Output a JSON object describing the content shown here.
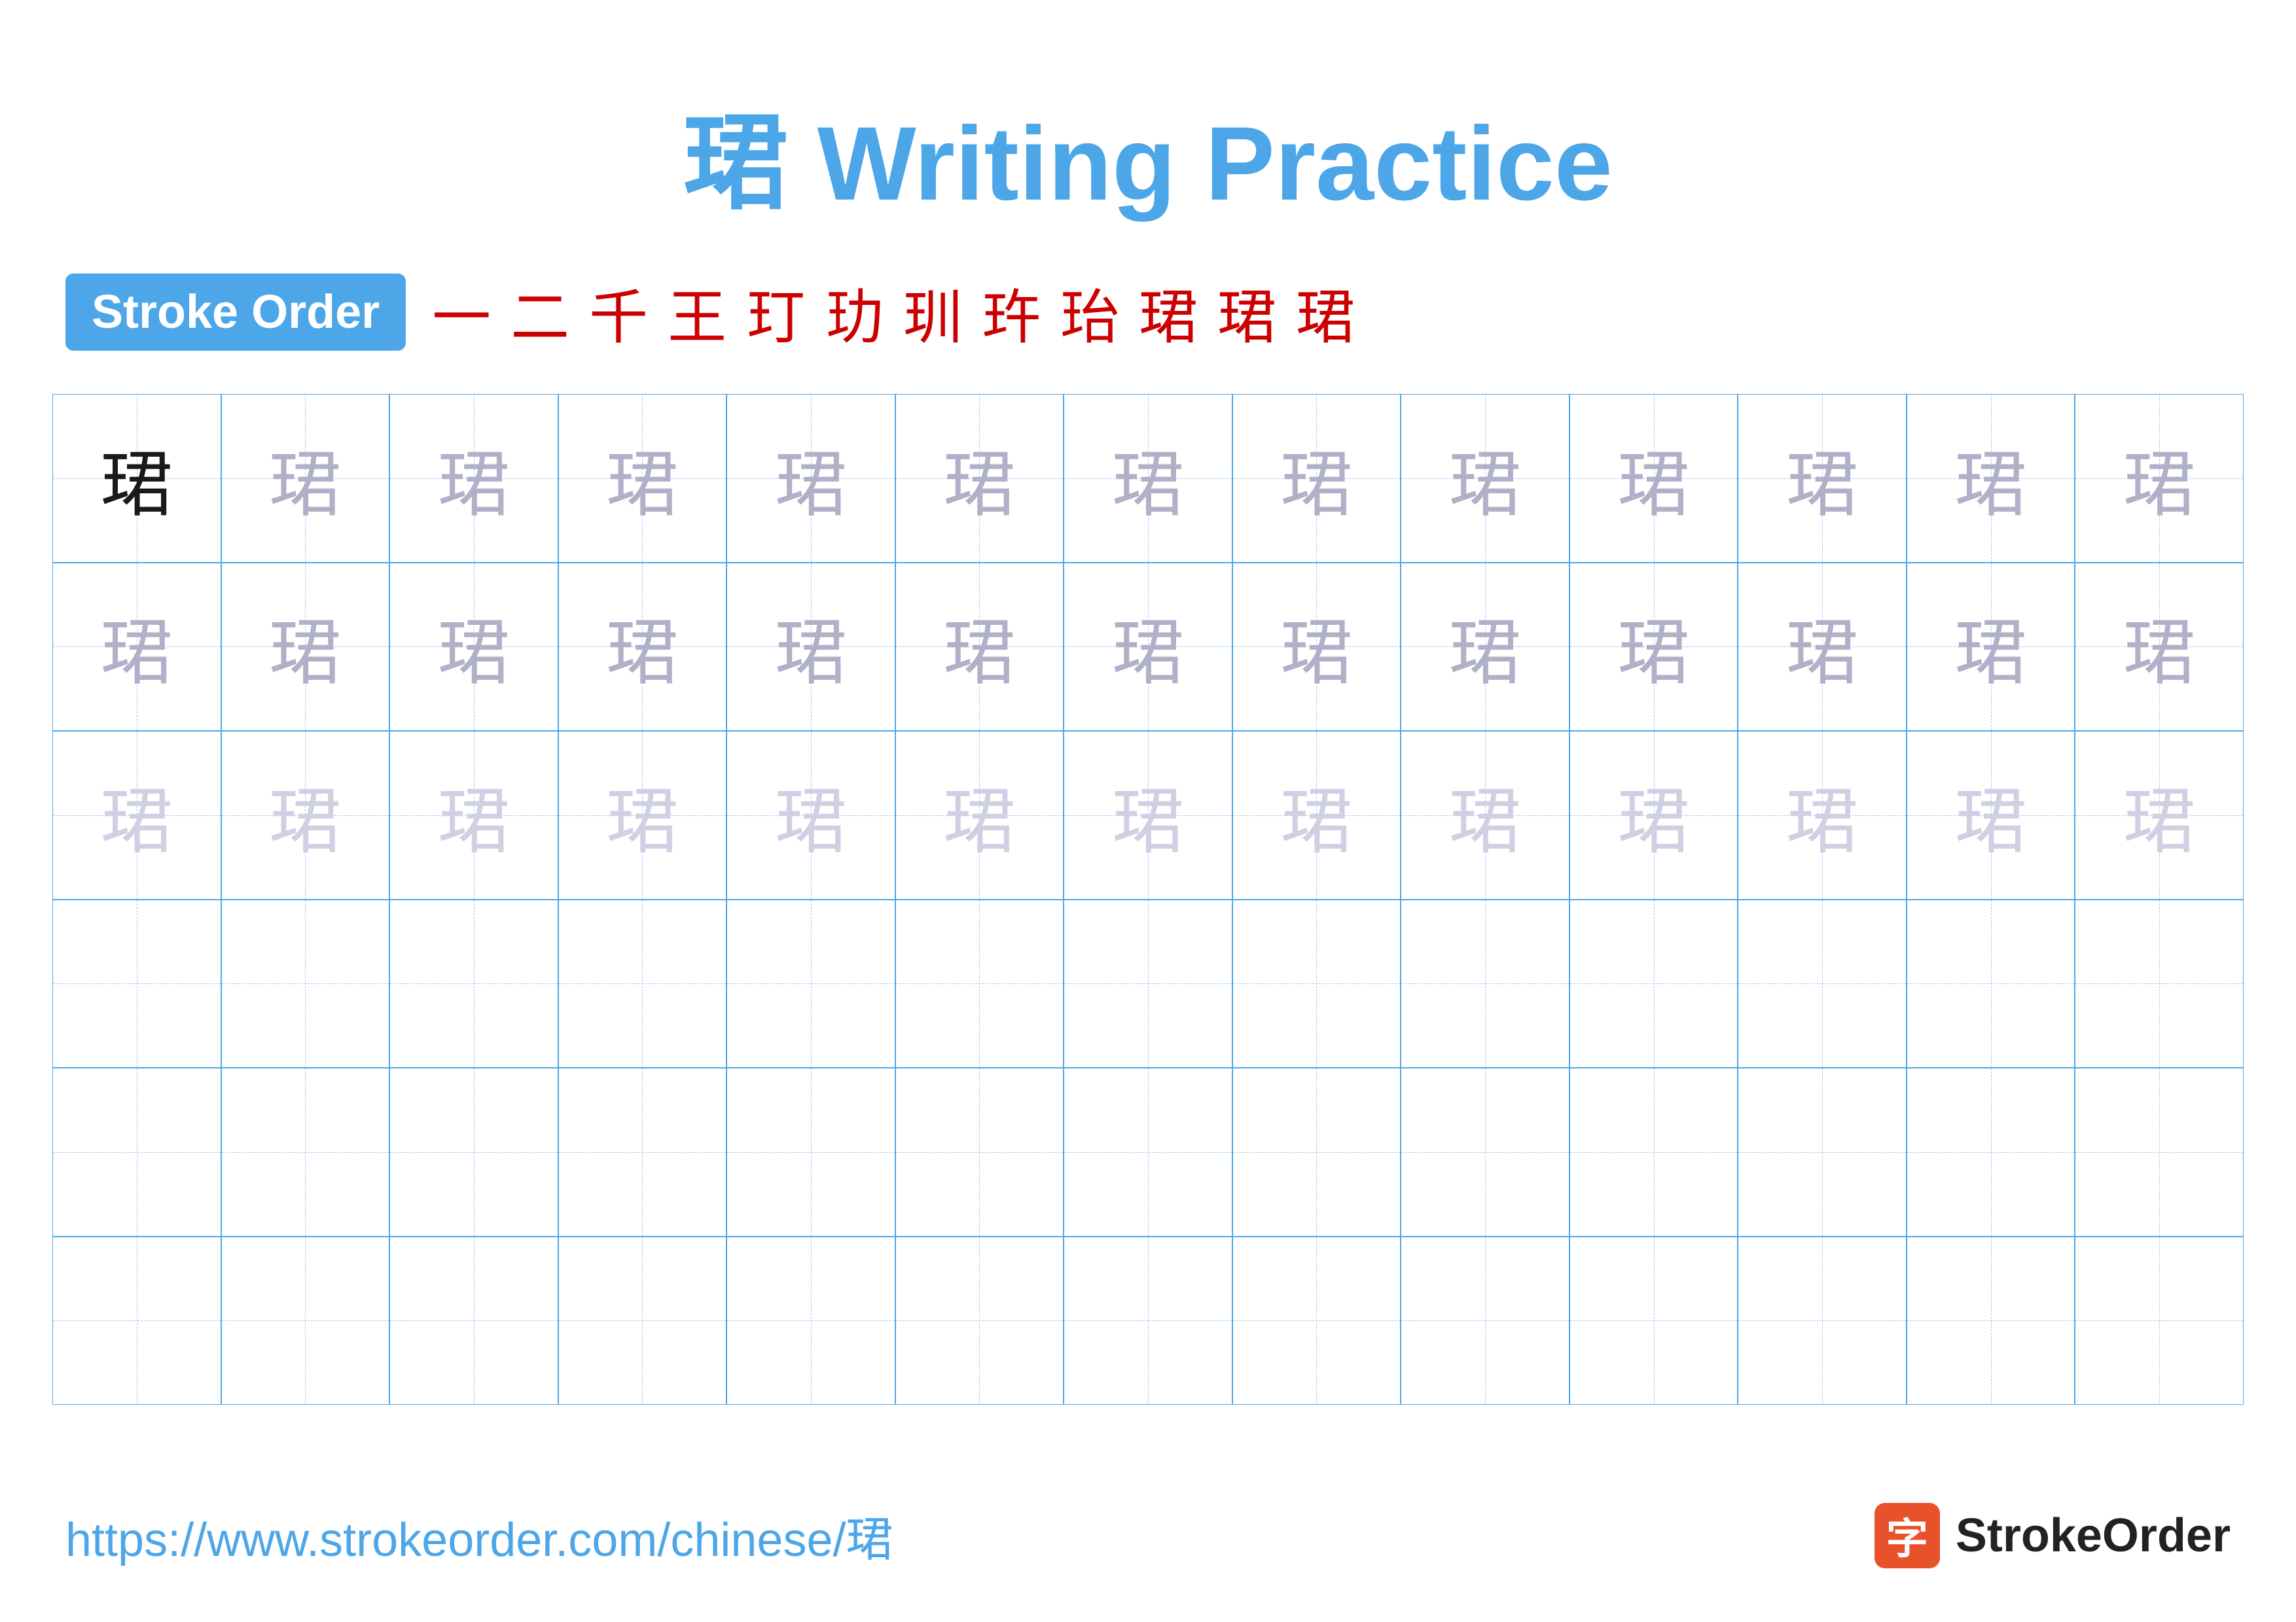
{
  "title": {
    "text": "珺 Writing Practice",
    "char": "珺"
  },
  "stroke_order": {
    "badge_label": "Stroke Order",
    "steps": [
      "一",
      "二",
      "千",
      "王",
      "玎",
      "玏",
      "玔",
      "玝",
      "珆",
      "珺",
      "珺",
      "珺"
    ]
  },
  "grid": {
    "rows": 6,
    "cols": 13,
    "char": "珺",
    "row_styles": [
      "dark+medium",
      "medium+medium",
      "light+light",
      "empty",
      "empty",
      "empty"
    ]
  },
  "footer": {
    "url": "https://www.strokeorder.com/chinese/珺",
    "logo_char": "字",
    "logo_name": "StrokeOrder"
  }
}
